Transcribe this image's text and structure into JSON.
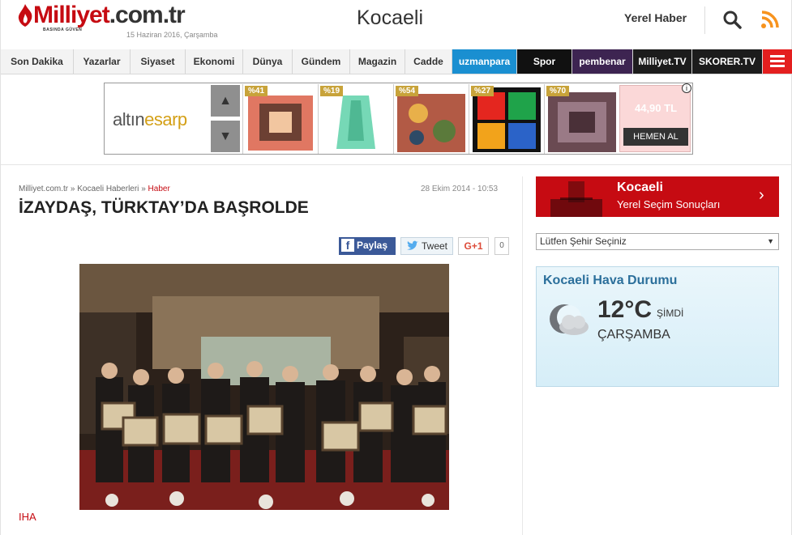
{
  "header": {
    "logo_main": "Milliyet",
    "logo_tld": ".com.tr",
    "logo_tagline": "BASINDA GÜVEN",
    "date": "15 Haziran 2016, Çarşamba",
    "title": "Kocaeli",
    "local_news": "Yerel Haber"
  },
  "nav": {
    "items": [
      "Son Dakika",
      "Yazarlar",
      "Siyaset",
      "Ekonomi",
      "Dünya",
      "Gündem",
      "Magazin",
      "Cadde"
    ],
    "brands": [
      "uzmanpara",
      "Spor",
      "pembenar",
      "Milliyet.TV",
      "SKORER.TV"
    ],
    "brand_colors": [
      "#1a8fd1",
      "#111111",
      "#3d2451",
      "#1c1c1c",
      "#1c1c1c"
    ]
  },
  "ad": {
    "brand_a": "altın",
    "brand_b": "esarp",
    "tiles": [
      {
        "pct": "%41",
        "color": "#c7443a"
      },
      {
        "pct": "%19",
        "color": "#6fd3b0"
      },
      {
        "pct": "%54",
        "color": "#a64a3a"
      },
      {
        "pct": "%27",
        "color": "#e4261f"
      },
      {
        "pct": "%70",
        "color": "#5d3b42"
      }
    ],
    "price": "44,90 TL",
    "buy_label": "HEMEN AL",
    "info": "i"
  },
  "article": {
    "breadcrumb": [
      "Milliyet.com.tr",
      "Kocaeli Haberleri",
      "Haber"
    ],
    "separator": "»",
    "date": "28 Ekim 2014 - 10:53",
    "title": "İZAYDAŞ, TÜRKTAY’DA BAŞROLDE",
    "share": {
      "facebook": "Paylaş",
      "twitter": "Tweet",
      "gplus": "G+1",
      "count": "0"
    },
    "source": "IHA"
  },
  "sidebar": {
    "election_city": "Kocaeli",
    "election_sub": "Yerel Seçim Sonuçları",
    "city_placeholder": "Lütfen Şehir Seçiniz",
    "weather_title": "Kocaeli Hava Durumu",
    "weather_temp": "12°C",
    "weather_now": "ŞİMDİ",
    "weather_day": "ÇARŞAMBA"
  },
  "colors": {
    "brand_red": "#c60b12",
    "facebook": "#3b5998",
    "gold": "#c8a33a"
  }
}
